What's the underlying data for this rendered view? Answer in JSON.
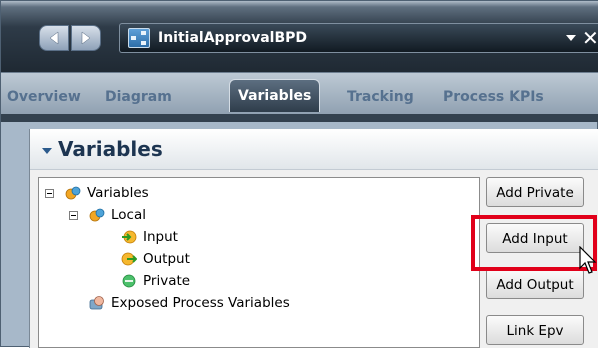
{
  "window": {
    "document_title": "InitialApprovalBPD",
    "icons": [
      "nav-back-icon",
      "nav-forward-icon",
      "process-diagram-icon",
      "dropdown-arrow-icon",
      "close-icon"
    ],
    "close_glyph": "✕"
  },
  "tabs": [
    {
      "label": "Overview",
      "active": false
    },
    {
      "label": "Diagram",
      "active": false
    },
    {
      "label": "Variables",
      "active": true
    },
    {
      "label": "Tracking",
      "active": false
    },
    {
      "label": "Process KPIs",
      "active": false
    }
  ],
  "panel": {
    "title": "Variables",
    "tree": [
      {
        "label": "Variables",
        "icon": "variables-group-icon",
        "level": 0,
        "expandable": true
      },
      {
        "label": "Local",
        "icon": "variables-group-icon",
        "level": 1,
        "expandable": true
      },
      {
        "label": "Input",
        "icon": "input-arrow-icon",
        "level": 2,
        "expandable": false
      },
      {
        "label": "Output",
        "icon": "output-arrow-icon",
        "level": 2,
        "expandable": false
      },
      {
        "label": "Private",
        "icon": "private-dot-icon",
        "level": 2,
        "expandable": false
      },
      {
        "label": "Exposed Process Variables",
        "icon": "exposed-variables-icon",
        "level": 1,
        "expandable": false
      }
    ],
    "buttons": {
      "add_private": "Add Private",
      "add_input": "Add Input",
      "add_output": "Add Output",
      "link_epv": "Link Epv"
    },
    "highlighted_button": "Add Input"
  },
  "colors": {
    "highlight": "#e1001a",
    "active_tab": "#3f5163",
    "inactive_tab_text": "#56718f",
    "panel_title": "#1d3551"
  }
}
